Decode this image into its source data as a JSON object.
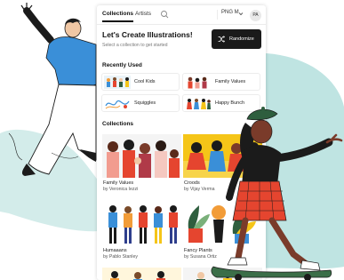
{
  "tabs": {
    "collections": "Collections",
    "artists": "Artists"
  },
  "format_select": {
    "value": "PNG M"
  },
  "user": {
    "initials": "PA"
  },
  "header": {
    "title": "Let's Create Illustrations!",
    "subtitle": "Select a collection to get started",
    "randomize_label": "Randomize"
  },
  "recently_used": {
    "title": "Recently Used",
    "items": [
      {
        "label": "Cool Kids"
      },
      {
        "label": "Family Values"
      },
      {
        "label": "Squiggles"
      },
      {
        "label": "Happy Bunch"
      }
    ]
  },
  "collections": {
    "title": "Collections",
    "cards": [
      {
        "title": "Family Values",
        "author": "by Veronica Iezzi"
      },
      {
        "title": "Croods",
        "author": "by Vijay Verma"
      },
      {
        "title": "Humaaans",
        "author": "by Pablo Stanley"
      },
      {
        "title": "Fancy Plants",
        "author": "by Susana Ortiz"
      },
      {
        "title": "",
        "author": ""
      },
      {
        "title": "",
        "author": ""
      }
    ]
  },
  "colors": {
    "mint": "#bfe4e2",
    "dark_button": "#1a1a1a",
    "shirt_blue": "#3a8fd8",
    "skirt_red": "#e5452f",
    "beret_green": "#2e5e3e",
    "board_green": "#3b6e48"
  },
  "icons": {
    "search": "search-icon",
    "chevron": "chevron-down-icon",
    "randomize": "shuffle-icon"
  }
}
